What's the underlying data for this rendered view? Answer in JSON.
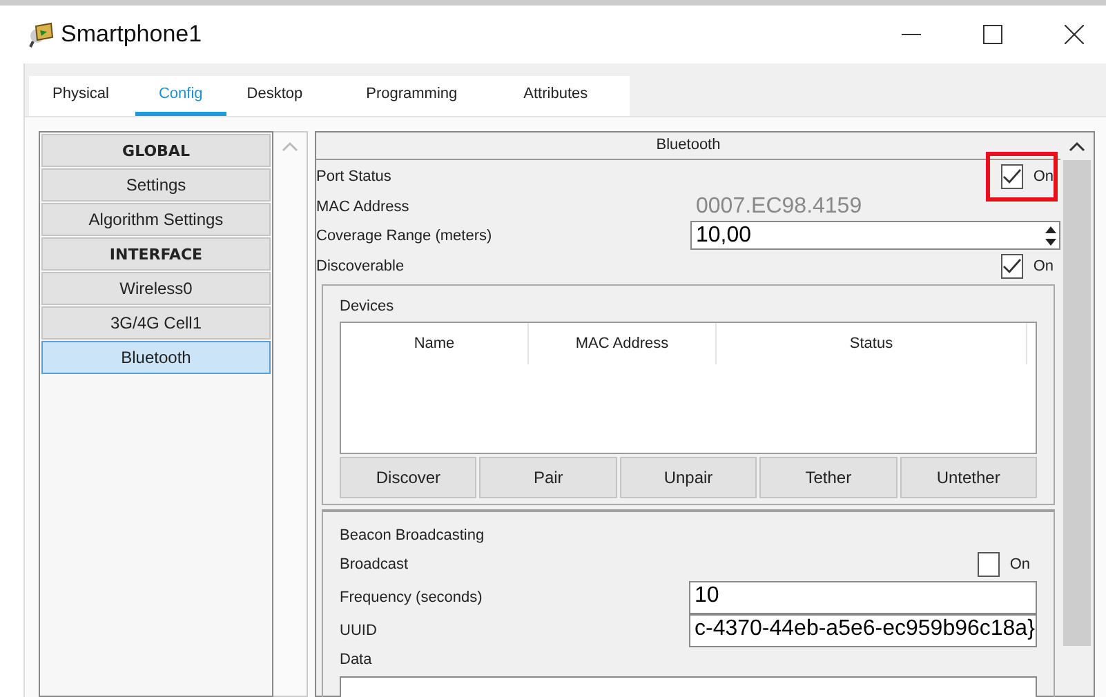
{
  "window": {
    "title": "Smartphone1"
  },
  "tabs": [
    {
      "label": "Physical",
      "selected": false
    },
    {
      "label": "Config",
      "selected": true
    },
    {
      "label": "Desktop",
      "selected": false
    },
    {
      "label": "Programming",
      "selected": false
    },
    {
      "label": "Attributes",
      "selected": false
    }
  ],
  "sidebar": {
    "items": [
      {
        "label": "GLOBAL",
        "kind": "header",
        "selected": false
      },
      {
        "label": "Settings",
        "kind": "item",
        "selected": false
      },
      {
        "label": "Algorithm Settings",
        "kind": "item",
        "selected": false
      },
      {
        "label": "INTERFACE",
        "kind": "header",
        "selected": false
      },
      {
        "label": "Wireless0",
        "kind": "item",
        "selected": false
      },
      {
        "label": "3G/4G Cell1",
        "kind": "item",
        "selected": false
      },
      {
        "label": "Bluetooth",
        "kind": "item",
        "selected": true
      }
    ]
  },
  "panel": {
    "title": "Bluetooth",
    "rows": [
      {
        "kind": "checkbox",
        "label": "Port Status",
        "checked": true,
        "option": "On",
        "highlighted": true
      },
      {
        "kind": "field",
        "label": "MAC Address",
        "value": "0007.EC98.4159",
        "disabled": true
      },
      {
        "kind": "spinner",
        "label": "Coverage Range (meters)",
        "value": "10,00"
      },
      {
        "kind": "checkbox",
        "label": "Discoverable",
        "checked": true,
        "option": "On"
      }
    ],
    "devices": {
      "title": "Devices",
      "columns": [
        "Name",
        "MAC Address",
        "Status"
      ],
      "buttons": [
        "Discover",
        "Pair",
        "Unpair",
        "Tether",
        "Untether"
      ]
    },
    "beacon": {
      "title": "Beacon Broadcasting",
      "rows": [
        {
          "kind": "checkbox",
          "label": "Broadcast",
          "checked": false,
          "option": "On"
        },
        {
          "kind": "field",
          "label": "Frequency (seconds)",
          "value": "10",
          "disabled": false
        },
        {
          "kind": "field",
          "label": "UUID",
          "value": "c-4370-44eb-a5e6-ec959b96c18a}",
          "disabled": false
        }
      ],
      "data": {
        "label": "Data"
      }
    }
  }
}
